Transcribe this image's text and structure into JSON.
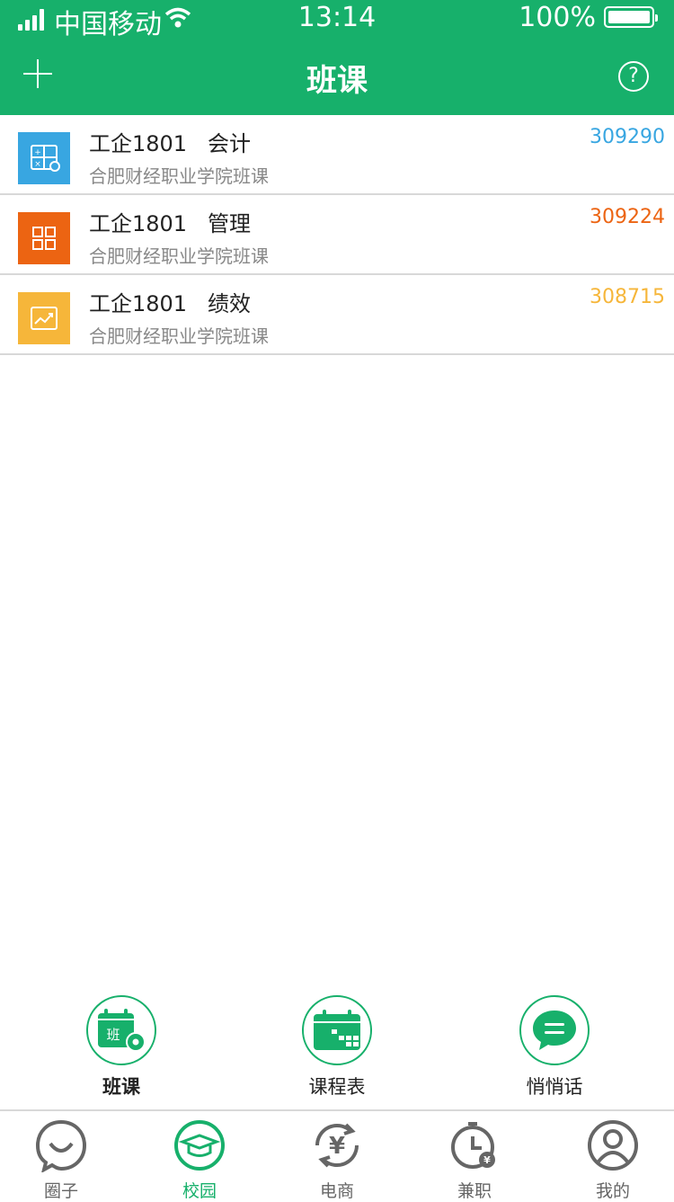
{
  "status_bar": {
    "carrier": "中国移动",
    "time": "13:14",
    "battery": "100%"
  },
  "header": {
    "title": "班课"
  },
  "classes": [
    {
      "name": "工企1801",
      "subject": "会计",
      "school": "合肥财经职业学院班课",
      "code": "309290",
      "color": "#38a6e1",
      "icon": "calculator-icon"
    },
    {
      "name": "工企1801",
      "subject": "管理",
      "school": "合肥财经职业学院班课",
      "code": "309224",
      "color": "#ec6412",
      "icon": "grid-icon"
    },
    {
      "name": "工企1801",
      "subject": "绩效",
      "school": "合肥财经职业学院班课",
      "code": "308715",
      "color": "#f6b63a",
      "icon": "trend-chart-icon"
    }
  ],
  "quick_actions": [
    {
      "label": "班课",
      "icon": "class-settings-icon",
      "icon_text": "班"
    },
    {
      "label": "课程表",
      "icon": "timetable-icon"
    },
    {
      "label": "悄悄话",
      "icon": "chat-icon"
    }
  ],
  "tabs": [
    {
      "label": "圈子",
      "icon": "circle-chat-icon"
    },
    {
      "label": "校园",
      "icon": "graduation-cap-icon",
      "active": true
    },
    {
      "label": "电商",
      "icon": "yen-refresh-icon"
    },
    {
      "label": "兼职",
      "icon": "clock-yen-icon"
    },
    {
      "label": "我的",
      "icon": "profile-icon"
    }
  ],
  "colors": {
    "accent": "#17b06b",
    "tab_inactive": "#666666"
  }
}
